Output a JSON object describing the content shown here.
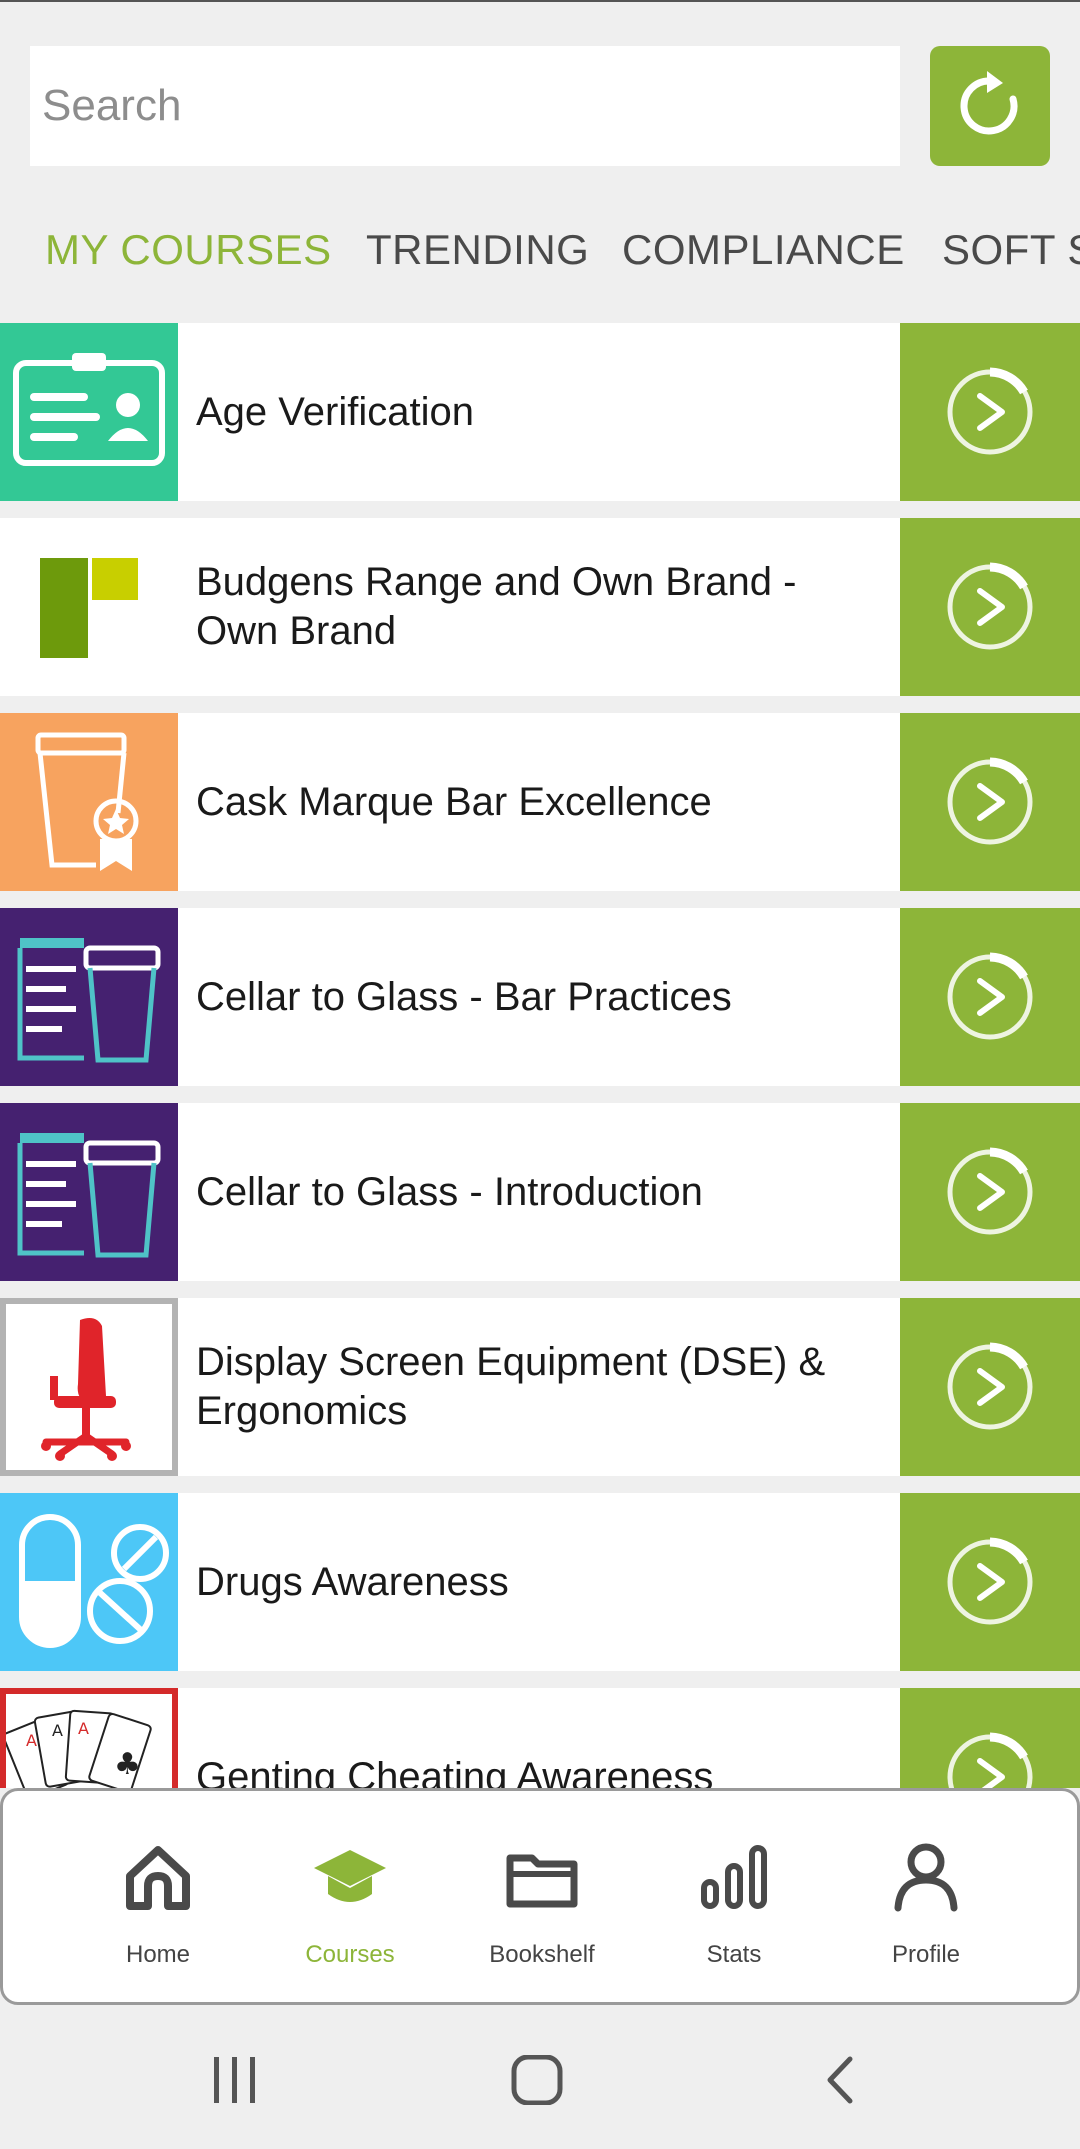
{
  "search": {
    "placeholder": "Search"
  },
  "tabs": [
    {
      "label": "MY COURSES"
    },
    {
      "label": "TRENDING"
    },
    {
      "label": "COMPLIANCE"
    },
    {
      "label": "SOFT S"
    }
  ],
  "courses": [
    {
      "title": "Age Verification",
      "thumb_color": "#33c895"
    },
    {
      "title": "Budgens Range and Own Brand - Own Brand",
      "thumb_color": "#ffffff"
    },
    {
      "title": "Cask Marque Bar Excellence",
      "thumb_color": "#f7a35f"
    },
    {
      "title": "Cellar to Glass - Bar Practices",
      "thumb_color": "#452170"
    },
    {
      "title": "Cellar to Glass - Introduction",
      "thumb_color": "#452170"
    },
    {
      "title": "Display Screen Equipment (DSE) & Ergonomics",
      "thumb_color": "#ffffff"
    },
    {
      "title": "Drugs Awareness",
      "thumb_color": "#4dc7f7"
    },
    {
      "title": "Genting Cheating Awareness",
      "thumb_color": "#ffffff"
    }
  ],
  "nav": [
    {
      "label": "Home",
      "icon": "home-icon"
    },
    {
      "label": "Courses",
      "icon": "graduation-cap-icon"
    },
    {
      "label": "Bookshelf",
      "icon": "folder-icon"
    },
    {
      "label": "Stats",
      "icon": "bar-chart-icon"
    },
    {
      "label": "Profile",
      "icon": "user-icon"
    }
  ],
  "colors": {
    "accent": "#8db539",
    "text_dark": "#1a1a1a"
  }
}
